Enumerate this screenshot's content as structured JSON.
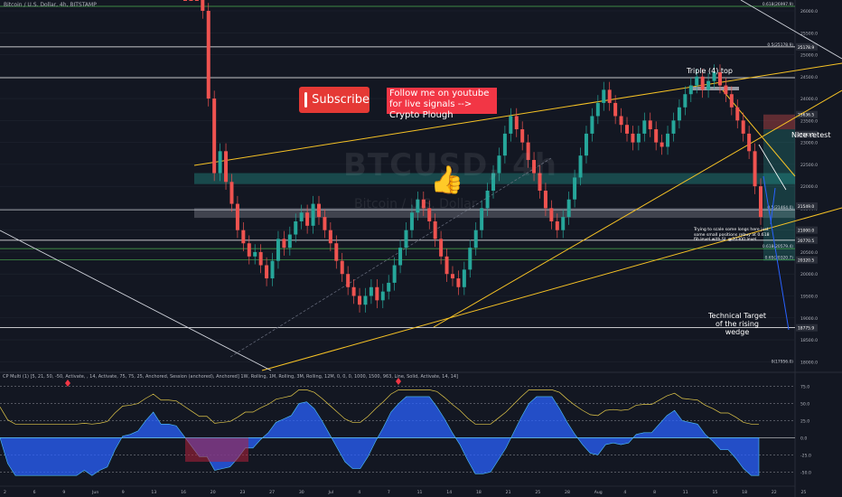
{
  "header": {
    "title": "Bitcoin / U.S. Dollar, 4h, BITSTAMP"
  },
  "overlays": {
    "subscribe_label": "Subscribe",
    "follow_text": "Follow me on youtube for live signals --> Crypto Plough",
    "watermark_symbol": "BTCUSD, 4h",
    "watermark_name": "Bitcoin / U.S. Dollar",
    "thumb_icon": "thumbs-up-icon",
    "play_icon": "play-icon"
  },
  "annotations": {
    "triple_top": "Triple (4) top",
    "nice_retest": "Nice retest",
    "target": "Technical Target of the rising wedge",
    "scale_note": "Trying to scale some longs here just some small positions rebuy at 0.618 fib level with SL @20300 level"
  },
  "oscillator": {
    "label": "CP Multi (1) [5, 21, 50, -50, Activate, , 14, Activate, 75, 75, 25, Anchored, Session (anchored), Anchored] 1W, Rolling, 1M, Rolling, 3M, Rolling, 12M, 0, 0, 0, 1000, 1500, 963, Line, Solid, Activate, 14, 14]",
    "levels": [
      75,
      50,
      25,
      0,
      -25,
      -50
    ],
    "level_labels": [
      "75.0",
      "50.0",
      "25.0",
      "0.0",
      "-25.0",
      "-50.0"
    ]
  },
  "colors": {
    "background": "#131722",
    "candle_up": "#26a69a",
    "candle_down": "#ef5350",
    "wedge": "#f7c325",
    "white_line": "#d1d4dc",
    "fib_green": "#4caf50",
    "target_arrow": "#2962ff",
    "osc_blue": "#2962ff",
    "osc_red": "#b2203a",
    "osc_green": "#3a8f3a",
    "osc_yellow": "#e3c94a"
  },
  "chart_data": {
    "type": "candlestick",
    "title": "Bitcoin / U.S. Dollar, 4h, BITSTAMP",
    "xlabel": "",
    "ylabel": "",
    "ylim": [
      17800,
      26000
    ],
    "y_ticks": [
      18000,
      18500,
      19000,
      19500,
      20000,
      20500,
      21000,
      21500,
      22000,
      22500,
      23000,
      23500,
      24000,
      24500,
      25000,
      25500,
      26000
    ],
    "y_tick_labels": [
      "18000.0",
      "18500.0",
      "19000.0",
      "19500.0",
      "20000.0",
      "20500.0",
      "21000.0",
      "21500.0",
      "22000.0",
      "22500.0",
      "23000.0",
      "23500.0",
      "24000.0",
      "24500.0",
      "25000.0",
      "25500.0",
      "26000.0"
    ],
    "x_tick_labels": [
      "2",
      "6",
      "9",
      "Jun",
      "9",
      "13",
      "16",
      "20",
      "23",
      "27",
      "30",
      "Jul",
      "4",
      "7",
      "11",
      "14",
      "18",
      "21",
      "25",
      "28",
      "Aug",
      "4",
      "8",
      "11",
      "15",
      "18",
      "22",
      "25"
    ],
    "closes": [
      31000,
      29500,
      28000,
      26000,
      24000,
      22300,
      22800,
      22100,
      21600,
      21000,
      20700,
      20400,
      20500,
      20200,
      19900,
      20300,
      20800,
      20600,
      20900,
      21200,
      21400,
      21100,
      21600,
      21300,
      21000,
      20700,
      20300,
      20000,
      19700,
      19500,
      19300,
      19500,
      19700,
      19400,
      19600,
      19800,
      20200,
      20600,
      21000,
      21400,
      21700,
      21500,
      21200,
      20800,
      20400,
      20000,
      19900,
      19700,
      20100,
      20600,
      21000,
      21500,
      21900,
      22300,
      22700,
      23200,
      23600,
      23300,
      23000,
      22600,
      22300,
      21900,
      21500,
      21200,
      21000,
      21300,
      21700,
      22200,
      22700,
      23200,
      23600,
      23900,
      24200,
      23900,
      23600,
      23400,
      23200,
      23000,
      23200,
      23500,
      23300,
      23000,
      22900,
      23200,
      23500,
      23800,
      24100,
      24300,
      24500,
      24200,
      24400,
      24600,
      24300,
      24100,
      23800,
      23500,
      23200,
      22800,
      22000,
      21300
    ],
    "price_labels": [
      {
        "value": 26997,
        "text": "0.618(26997.9)"
      },
      {
        "value": 25178,
        "text": "0.5(25178.9)"
      },
      {
        "value": 21464,
        "text": "0.5(21464.0)"
      },
      {
        "value": 20579,
        "text": "0.618(20579.4)"
      },
      {
        "value": 20320,
        "text": "0.65(20320.7)"
      },
      {
        "value": 17956,
        "text": "0(17956.0)"
      }
    ],
    "level_tags": [
      {
        "value": 25178.9,
        "text": "25178.9"
      },
      {
        "value": 23636.5,
        "text": "23636.5"
      },
      {
        "value": 23183.1,
        "text": "23183.1"
      },
      {
        "value": 21549,
        "text": "21549.0"
      },
      {
        "value": 21000,
        "text": "21000.0"
      },
      {
        "value": 20770,
        "text": "20770.5"
      },
      {
        "value": 20320,
        "text": "20320.5"
      },
      {
        "value": 18775,
        "text": "18775.9"
      }
    ]
  }
}
